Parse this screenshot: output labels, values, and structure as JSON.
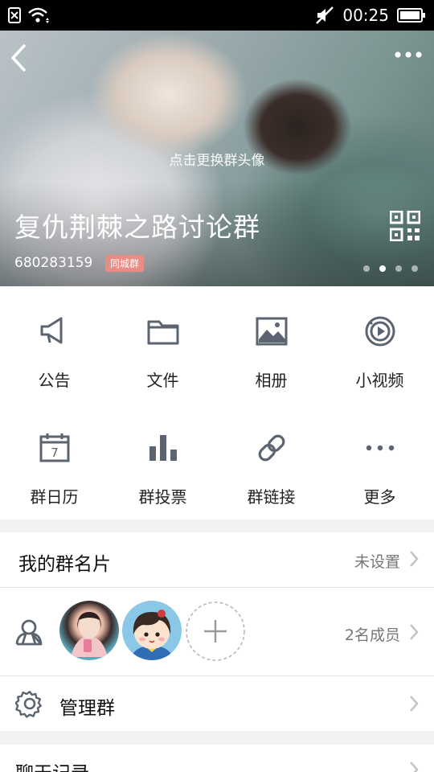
{
  "status_bar": {
    "time": "00:25"
  },
  "hero": {
    "change_avatar_text": "点击更换群头像",
    "group_name": "复仇荆棘之路讨论群",
    "group_id": "680283159",
    "badge": "同城群"
  },
  "features": [
    {
      "label": "公告",
      "icon": "megaphone-icon"
    },
    {
      "label": "文件",
      "icon": "folder-icon"
    },
    {
      "label": "相册",
      "icon": "album-icon"
    },
    {
      "label": "小视频",
      "icon": "short-video-icon"
    },
    {
      "label": "群日历",
      "icon": "calendar-icon"
    },
    {
      "label": "群投票",
      "icon": "vote-icon"
    },
    {
      "label": "群链接",
      "icon": "link-icon"
    },
    {
      "label": "更多",
      "icon": "more-icon"
    }
  ],
  "calendar_day": "7",
  "group_card": {
    "label": "我的群名片",
    "value": "未设置"
  },
  "members": {
    "count_text": "2名成员"
  },
  "manage": {
    "label": "管理群"
  },
  "chat_history": {
    "label": "聊天记录"
  },
  "colors": {
    "icon": "#5b6470",
    "badge": "#e88d86",
    "text": "#222222"
  }
}
